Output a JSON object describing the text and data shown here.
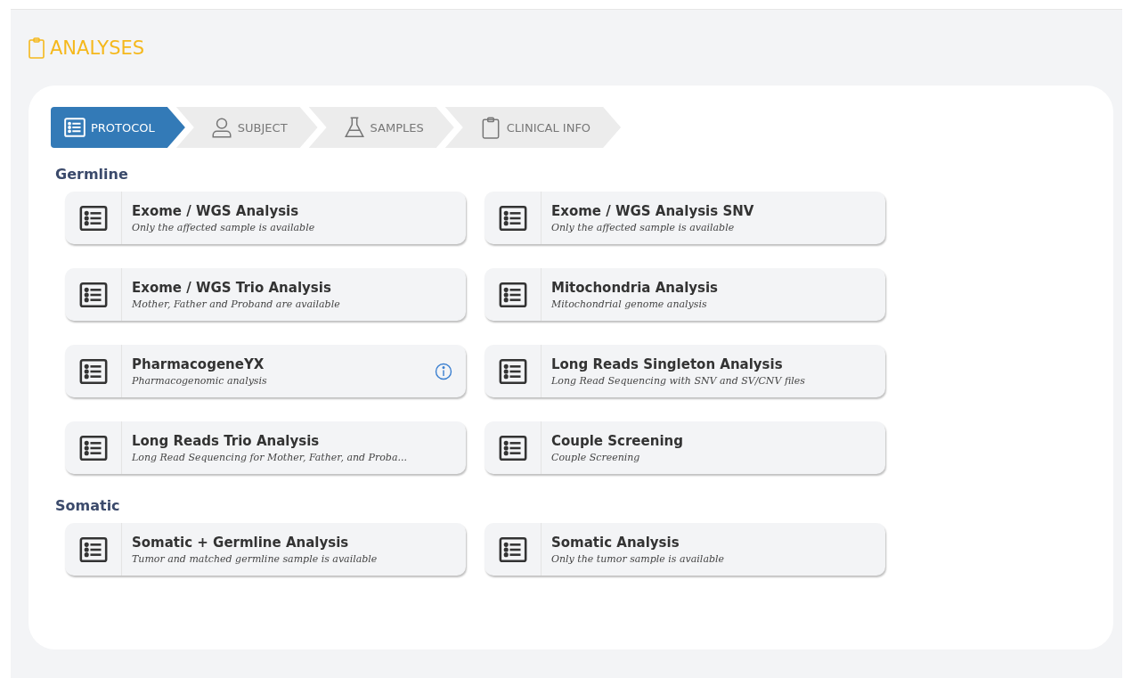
{
  "page_title": "ANALYSES",
  "steps": [
    {
      "label": "PROTOCOL",
      "kind": "list",
      "selected": true
    },
    {
      "label": "SUBJECT",
      "kind": "person",
      "selected": false
    },
    {
      "label": "SAMPLES",
      "kind": "flask",
      "selected": false
    },
    {
      "label": "CLINICAL INFO",
      "kind": "clipboard",
      "selected": false
    }
  ],
  "sections": [
    {
      "title": "Germline",
      "analyses": [
        {
          "name": "Exome / WGS Analysis",
          "description": "Only the affected sample is available",
          "info": false
        },
        {
          "name": "Exome / WGS Analysis SNV",
          "description": "Only the affected sample is available",
          "info": false
        },
        {
          "name": "Exome / WGS Trio Analysis",
          "description": "Mother, Father and Proband are available",
          "info": false
        },
        {
          "name": "Mitochondria Analysis",
          "description": "Mitochondrial genome analysis",
          "info": false
        },
        {
          "name": "PharmacogeneYX",
          "description": "Pharmacogenomic analysis",
          "info": true
        },
        {
          "name": "Long Reads Singleton Analysis",
          "description": "Long Read Sequencing with SNV and SV/CNV files",
          "info": false
        },
        {
          "name": "Long Reads Trio Analysis",
          "description": "Long Read Sequencing for Mother, Father, and Proba...",
          "info": false
        },
        {
          "name": "Couple Screening",
          "description": "Couple Screening",
          "info": false
        }
      ]
    },
    {
      "title": "Somatic",
      "analyses": [
        {
          "name": "Somatic + Germline Analysis",
          "description": "Tumor and matched germline sample is available",
          "info": false
        },
        {
          "name": "Somatic Analysis",
          "description": "Only the tumor sample is available",
          "info": false
        }
      ]
    }
  ]
}
